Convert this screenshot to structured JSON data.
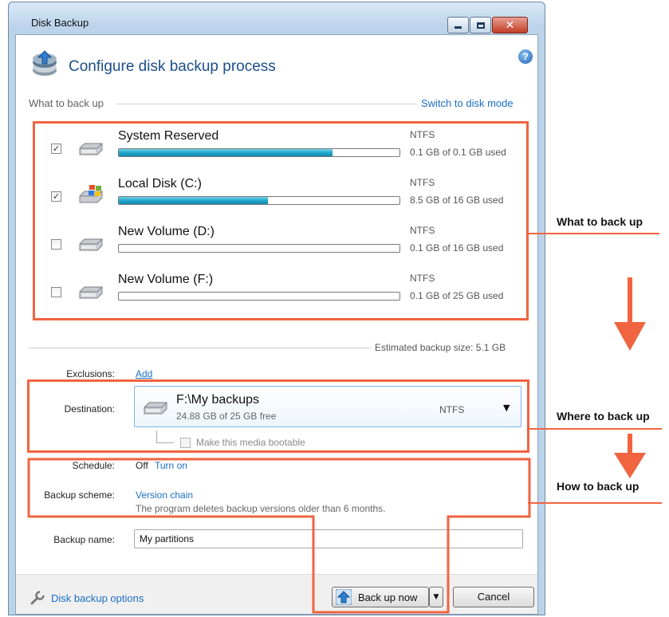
{
  "window": {
    "title": "Disk Backup",
    "header_title": "Configure disk backup process",
    "help_glyph": "?"
  },
  "what": {
    "label": "What to back up",
    "switch_link": "Switch to disk mode"
  },
  "volumes": [
    {
      "name": "System Reserved",
      "fs": "NTFS",
      "used": "0.1 GB of 0.1 GB used",
      "checked": true,
      "fill": 0.76,
      "icon": "drive-icon"
    },
    {
      "name": "Local Disk (C:)",
      "fs": "NTFS",
      "used": "8.5 GB of 16 GB used",
      "checked": true,
      "fill": 0.53,
      "icon": "windows-drive-icon"
    },
    {
      "name": "New Volume (D:)",
      "fs": "NTFS",
      "used": "0.1 GB of 16 GB used",
      "checked": false,
      "fill": 0.0,
      "icon": "drive-icon"
    },
    {
      "name": "New Volume (F:)",
      "fs": "NTFS",
      "used": "0.1 GB of 25 GB used",
      "checked": false,
      "fill": 0.0,
      "icon": "drive-icon"
    }
  ],
  "estimate": "Estimated backup size: 5.1 GB",
  "exclusions": {
    "label": "Exclusions:",
    "link": "Add"
  },
  "destination": {
    "label": "Destination:",
    "path": "F:\\My backups",
    "free": "24.88 GB of 25 GB free",
    "fs": "NTFS",
    "bootable_label": "Make this media bootable"
  },
  "schedule": {
    "label": "Schedule:",
    "state": "Off",
    "link": "Turn on"
  },
  "scheme": {
    "label": "Backup scheme:",
    "link": "Version chain",
    "description": "The program deletes backup versions older than 6 months."
  },
  "backup_name": {
    "label": "Backup name:",
    "value": "My partitions"
  },
  "footer": {
    "options_link": "Disk backup options",
    "backup_button": "Back up now",
    "cancel_button": "Cancel"
  },
  "annotations": {
    "what": "What to back up",
    "where": "Where to back up",
    "how": "How to back up",
    "accent_color": "#f06440"
  },
  "colors": {
    "link": "#1d6ec7",
    "progress": "#1ea3c6",
    "title": "#1c4f8a"
  }
}
